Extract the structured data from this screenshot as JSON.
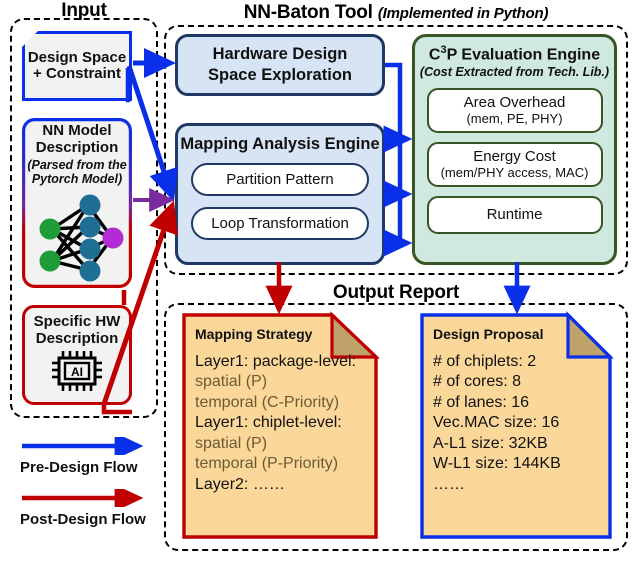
{
  "sections": {
    "input": {
      "title": "Input"
    },
    "tool": {
      "title": "NN-Baton Tool",
      "subtitle": "(Implemented in Python)"
    },
    "output": {
      "title": "Output Report"
    }
  },
  "input_boxes": {
    "design_space": {
      "line1": "Design Space",
      "line2": "+ Constraint"
    },
    "nn_model": {
      "line1": "NN Model",
      "line2": "Description",
      "note1": "(Parsed from the",
      "note2": "Pytorch Model)",
      "graphic": "neural-network-graph"
    },
    "specific_hw": {
      "line1": "Specific HW",
      "line2": "Description",
      "graphic": "ai-chip-icon",
      "chip_label": "AI"
    }
  },
  "tool_boxes": {
    "hdse": {
      "line1": "Hardware Design",
      "line2": "Space Exploration"
    },
    "mapping_engine": {
      "title": "Mapping Analysis Engine",
      "items": [
        {
          "label": "Partition Pattern"
        },
        {
          "label": "Loop Transformation"
        }
      ]
    },
    "c3p": {
      "title_pre": "C",
      "title_sup": "3",
      "title_post": "P Evaluation Engine",
      "subtitle": "(Cost Extracted from Tech. Lib.)",
      "items": [
        {
          "line1": "Area Overhead",
          "line2": "(mem, PE, PHY)"
        },
        {
          "line1": "Energy Cost",
          "line2": "(mem/PHY access, MAC)"
        },
        {
          "line1": "Runtime",
          "line2": ""
        }
      ]
    }
  },
  "output_notes": {
    "mapping_strategy": {
      "title": "Mapping Strategy",
      "lines": [
        {
          "text": "Layer1: package-level:",
          "dim": false
        },
        {
          "text": "spatial (P)",
          "dim": true
        },
        {
          "text": "temporal (C-Priority)",
          "dim": true
        },
        {
          "text": "Layer1: chiplet-level:",
          "dim": false
        },
        {
          "text": "spatial (P)",
          "dim": true
        },
        {
          "text": "temporal (P-Priority)",
          "dim": true
        },
        {
          "text": "Layer2: ……",
          "dim": false
        }
      ]
    },
    "design_proposal": {
      "title": "Design Proposal",
      "lines": [
        {
          "text": "# of chiplets: 2",
          "dim": false
        },
        {
          "text": "# of cores: 8",
          "dim": false
        },
        {
          "text": "# of lanes: 16",
          "dim": false
        },
        {
          "text": "Vec.MAC size: 16",
          "dim": false
        },
        {
          "text": "A-L1 size: 32KB",
          "dim": false
        },
        {
          "text": "W-L1 size: 144KB",
          "dim": false
        },
        {
          "text": "……",
          "dim": false
        }
      ]
    }
  },
  "legend": {
    "pre_design": {
      "label": "Pre-Design Flow",
      "color": "#0a2fe8"
    },
    "post_design": {
      "label": "Post-Design Flow",
      "color": "#c00000"
    }
  },
  "colors": {
    "blue_flow": "#0a2fe8",
    "red_flow": "#c00000",
    "purple_flow": "#7a2a9e",
    "navy_border": "#1f3864",
    "light_blue_fill": "#d6e4f5",
    "green_border": "#375623",
    "mint_fill": "#cfe8e0",
    "note_fill": "#fbd89a",
    "note_fold": "#bfa26a",
    "node_fill": "#f2f2f2",
    "nn_node_input": "#1f9c3a",
    "nn_node_hidden": "#1f6f94",
    "nn_node_output": "#b32bd4"
  }
}
